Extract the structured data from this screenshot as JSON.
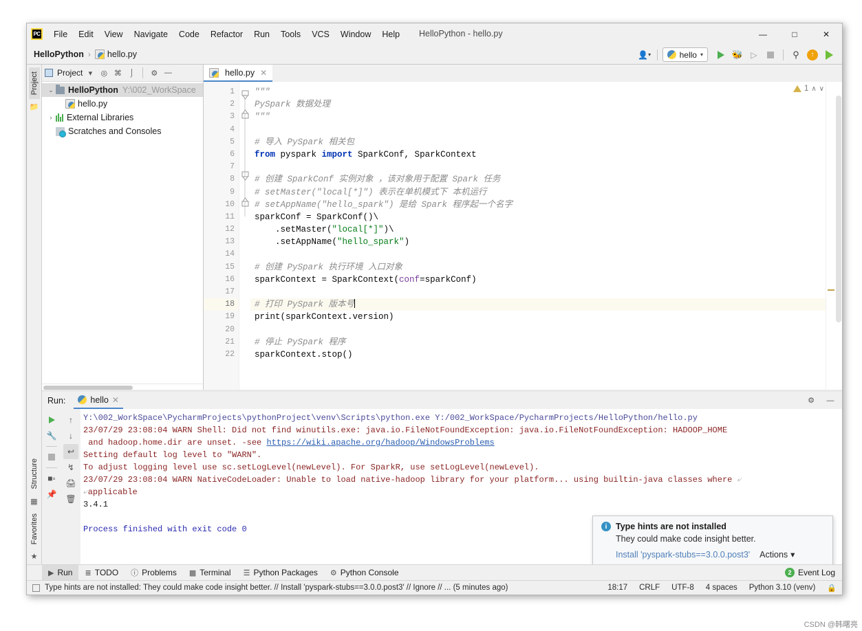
{
  "window": {
    "title": "HelloPython - hello.py",
    "logo_text": "PC",
    "minimize": "—",
    "maximize": "□",
    "close": "✕"
  },
  "menu": [
    {
      "label": "File"
    },
    {
      "label": "Edit"
    },
    {
      "label": "View"
    },
    {
      "label": "Navigate"
    },
    {
      "label": "Code"
    },
    {
      "label": "Refactor"
    },
    {
      "label": "Run"
    },
    {
      "label": "Tools"
    },
    {
      "label": "VCS"
    },
    {
      "label": "Window"
    },
    {
      "label": "Help"
    }
  ],
  "breadcrumb": {
    "project": "HelloPython",
    "separator": "›",
    "file": "hello.py"
  },
  "toolbar": {
    "profile_icon": "user-profile-icon",
    "run_config_label": "hello",
    "run_icon": "run-icon",
    "debug_icon": "debug-icon",
    "coverage_icon": "run-with-coverage-icon",
    "stop_icon": "stop-icon",
    "search_icon": "🔍",
    "update_icon": "↑",
    "profiler_icon": "profiler-icon"
  },
  "left_strip": {
    "project_tab": "Project",
    "structure_tab": "Structure",
    "favorites_tab": "Favorites"
  },
  "project_pane": {
    "title": "Project",
    "icons": [
      "locate-icon",
      "collapse-icon",
      "expand-icon",
      "settings-icon",
      "hide-icon"
    ],
    "tree": [
      {
        "label": "HelloPython",
        "path": "Y:\\002_WorkSpace",
        "icon": "folder-icon",
        "arrow": "⌄",
        "bold": true,
        "selected": true,
        "indent": 0
      },
      {
        "label": "hello.py",
        "path": "",
        "icon": "python-file-icon",
        "arrow": "",
        "bold": false,
        "selected": false,
        "indent": 1
      },
      {
        "label": "External Libraries",
        "path": "",
        "icon": "libraries-icon",
        "arrow": "›",
        "bold": false,
        "selected": false,
        "indent": 0
      },
      {
        "label": "Scratches and Consoles",
        "path": "",
        "icon": "scratches-icon",
        "arrow": "",
        "bold": false,
        "selected": false,
        "indent": 0
      }
    ]
  },
  "editor": {
    "tab_label": "hello.py",
    "tab_close": "✕",
    "inspection_count": "1",
    "inspection_up": "∧",
    "inspection_down": "∨",
    "current_line": 18,
    "lines": [
      {
        "n": 1,
        "tokens": [
          {
            "t": "\"\"\"",
            "c": "strq"
          }
        ]
      },
      {
        "n": 2,
        "tokens": [
          {
            "t": "PySpark 数据处理",
            "c": "strq"
          }
        ]
      },
      {
        "n": 3,
        "tokens": [
          {
            "t": "\"\"\"",
            "c": "strq"
          }
        ]
      },
      {
        "n": 4,
        "tokens": []
      },
      {
        "n": 5,
        "tokens": [
          {
            "t": "# 导入 PySpark 相关包",
            "c": "cmt"
          }
        ]
      },
      {
        "n": 6,
        "tokens": [
          {
            "t": "from",
            "c": "kw"
          },
          {
            "t": " pyspark ",
            "c": "plain"
          },
          {
            "t": "import",
            "c": "kw"
          },
          {
            "t": " SparkConf, SparkContext",
            "c": "plain"
          }
        ]
      },
      {
        "n": 7,
        "tokens": []
      },
      {
        "n": 8,
        "tokens": [
          {
            "t": "# 创建 SparkConf 实例对象 ，该对象用于配置 Spark 任务",
            "c": "cmt"
          }
        ]
      },
      {
        "n": 9,
        "tokens": [
          {
            "t": "# setMaster(\"local[*]\") 表示在单机模式下 本机运行",
            "c": "cmt"
          }
        ]
      },
      {
        "n": 10,
        "tokens": [
          {
            "t": "# setAppName(\"hello_spark\") 是给 Spark 程序起一个名字",
            "c": "cmt"
          }
        ]
      },
      {
        "n": 11,
        "tokens": [
          {
            "t": "sparkConf = SparkConf()\\",
            "c": "plain"
          }
        ]
      },
      {
        "n": 12,
        "tokens": [
          {
            "t": "    .setMaster(",
            "c": "plain"
          },
          {
            "t": "\"local[*]\"",
            "c": "str"
          },
          {
            "t": ")\\",
            "c": "plain"
          }
        ]
      },
      {
        "n": 13,
        "tokens": [
          {
            "t": "    .setAppName(",
            "c": "plain"
          },
          {
            "t": "\"hello_spark\"",
            "c": "str"
          },
          {
            "t": ")",
            "c": "plain"
          }
        ]
      },
      {
        "n": 14,
        "tokens": []
      },
      {
        "n": 15,
        "tokens": [
          {
            "t": "# 创建 PySpark 执行环境 入口对象",
            "c": "cmt"
          }
        ]
      },
      {
        "n": 16,
        "tokens": [
          {
            "t": "sparkContext = SparkContext(",
            "c": "plain"
          },
          {
            "t": "conf",
            "c": "kwarg"
          },
          {
            "t": "=sparkConf)",
            "c": "plain"
          }
        ]
      },
      {
        "n": 17,
        "tokens": []
      },
      {
        "n": 18,
        "tokens": [
          {
            "t": "# 打印 PySpark 版本号",
            "c": "cmt"
          }
        ]
      },
      {
        "n": 19,
        "tokens": [
          {
            "t": "print(sparkContext.version)",
            "c": "plain"
          }
        ]
      },
      {
        "n": 20,
        "tokens": []
      },
      {
        "n": 21,
        "tokens": [
          {
            "t": "# 停止 PySpark 程序",
            "c": "cmt"
          }
        ]
      },
      {
        "n": 22,
        "tokens": [
          {
            "t": "sparkContext.stop()",
            "c": "plain"
          }
        ]
      }
    ]
  },
  "run_panel": {
    "label": "Run:",
    "tab_label": "hello",
    "tab_close": "✕",
    "settings_icon": "⚙",
    "hide_icon": "—",
    "tool_icons": [
      "rerun-icon",
      "wrench-icon",
      "stop-icon",
      "layout-icon",
      "pin-icon"
    ],
    "nav_icons": [
      "up-arrow-icon",
      "down-arrow-icon",
      "soft-wrap-icon",
      "scroll-to-end-icon",
      "print-icon",
      "trash-icon"
    ],
    "console": [
      {
        "segments": [
          {
            "t": "Y:\\002_WorkSpace\\PycharmProjects\\pythonProject\\venv\\Scripts\\python.exe Y:/002_WorkSpace/PycharmProjects/HelloPython/hello.py",
            "c": "c-path"
          }
        ]
      },
      {
        "segments": [
          {
            "t": "23/07/29 23:08:04 WARN Shell: Did not find winutils.exe: java.io.FileNotFoundException: java.io.FileNotFoundException: HADOOP_HOME",
            "c": "c-warn"
          }
        ]
      },
      {
        "segments": [
          {
            "t": " and hadoop.home.dir are unset. -see ",
            "c": "c-warn"
          },
          {
            "t": "https://wiki.apache.org/hadoop/WindowsProblems",
            "c": "c-link"
          }
        ]
      },
      {
        "segments": [
          {
            "t": "Setting default log level to \"WARN\".",
            "c": "c-warn"
          }
        ]
      },
      {
        "segments": [
          {
            "t": "To adjust logging level use sc.setLogLevel(newLevel). For SparkR, use setLogLevel(newLevel).",
            "c": "c-warn"
          }
        ]
      },
      {
        "segments": [
          {
            "t": "23/07/29 23:08:04 WARN NativeCodeLoader: Unable to load native-hadoop library for your platform... using builtin-java classes where ",
            "c": "c-warn"
          },
          {
            "t": "⤶",
            "c": "c-wrap"
          }
        ]
      },
      {
        "segments": [
          {
            "t": "⤶",
            "c": "c-wrap"
          },
          {
            "t": "applicable",
            "c": "c-warn"
          }
        ]
      },
      {
        "segments": [
          {
            "t": "3.4.1",
            "c": "c-plain"
          }
        ]
      },
      {
        "segments": []
      },
      {
        "segments": [
          {
            "t": "Process finished with exit code 0",
            "c": "c-ok"
          }
        ]
      }
    ]
  },
  "balloon": {
    "info_icon": "i",
    "title": "Type hints are not installed",
    "subtitle": "They could make code insight better.",
    "install_link": "Install 'pyspark-stubs==3.0.0.post3'",
    "actions_label": "Actions",
    "actions_caret": "▾"
  },
  "bottom_tabs": [
    {
      "label": "Run",
      "icon": "run-icon",
      "selected": true
    },
    {
      "label": "TODO",
      "icon": "todo-icon",
      "selected": false
    },
    {
      "label": "Problems",
      "icon": "problems-icon",
      "selected": false
    },
    {
      "label": "Terminal",
      "icon": "terminal-icon",
      "selected": false
    },
    {
      "label": "Python Packages",
      "icon": "packages-icon",
      "selected": false
    },
    {
      "label": "Python Console",
      "icon": "python-console-icon",
      "selected": false
    }
  ],
  "event_log": {
    "count": "2",
    "label": "Event Log"
  },
  "statusbar": {
    "message": "Type hints are not installed: They could make code insight better. // Install 'pyspark-stubs==3.0.0.post3' // Ignore // ... (5 minutes ago)",
    "time": "18:17",
    "line_sep": "CRLF",
    "encoding": "UTF-8",
    "indent": "4 spaces",
    "interpreter": "Python 3.10 (venv)",
    "lock_icon": "lock-icon"
  },
  "watermark": "CSDN @韩曙亮"
}
